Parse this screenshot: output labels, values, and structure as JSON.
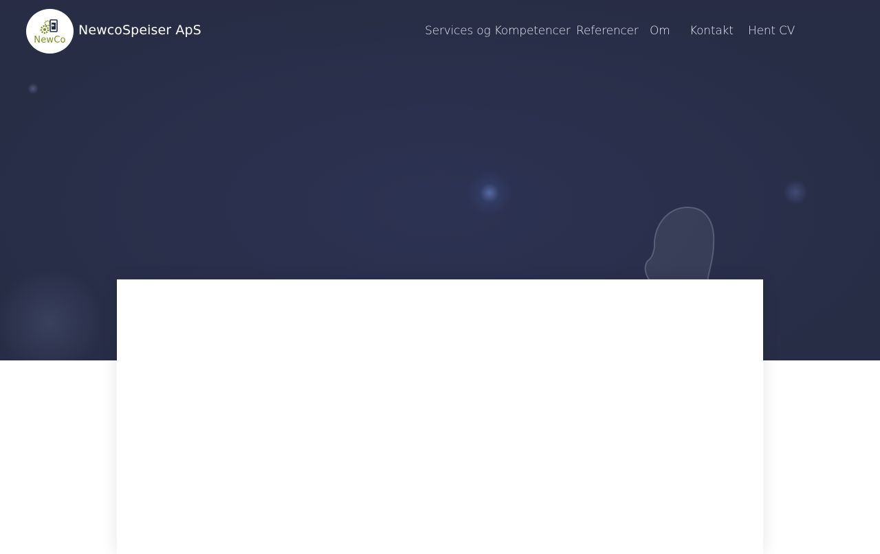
{
  "header": {
    "logo": {
      "text": "NewCo",
      "icon": "gears-logo-icon",
      "text_color": "#7a8f1c"
    },
    "brand_name": "NewcoSpeiser ApS"
  },
  "nav": {
    "items": [
      {
        "label": "Services og Kompetencer"
      },
      {
        "label": "Referencer"
      },
      {
        "label": "Om"
      },
      {
        "label": "Kontakt"
      },
      {
        "label": "Hent CV"
      }
    ]
  },
  "colors": {
    "hero_overlay": "#2a2f48",
    "nav_text": "#e6e8ee",
    "page_background": "#ffffff",
    "logo_accent": "#7a8f1c"
  }
}
